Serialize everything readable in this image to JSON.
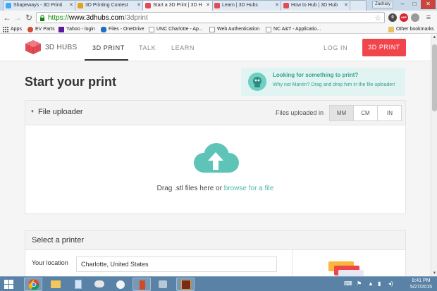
{
  "browser": {
    "tabs": [
      {
        "title": "Shapeways - 3D Printi",
        "icon": "shapeways-favicon",
        "color": "#3fa9f5",
        "active": false
      },
      {
        "title": "3D Printing Contest",
        "icon": "contest-favicon",
        "color": "#e3a21a",
        "active": false
      },
      {
        "title": "Start a 3D Print | 3D H",
        "icon": "3dhubs-favicon",
        "color": "#e24a55",
        "active": true
      },
      {
        "title": "Learn | 3D Hubs",
        "icon": "3dhubs-favicon",
        "color": "#e24a55",
        "active": false
      },
      {
        "title": "How to Hub | 3D Hub",
        "icon": "3dhubs-favicon",
        "color": "#e24a55",
        "active": false
      }
    ],
    "profile": "Zachary",
    "url": {
      "scheme": "https://",
      "host": "www.3dhubs.com",
      "path": "/3dprint"
    },
    "extensions": [
      "ghostery-icon",
      "adblock-icon",
      "pin-icon"
    ],
    "extension_labels": [
      "0",
      "ABP",
      ""
    ],
    "bookmarks": [
      {
        "label": "Apps",
        "icon": "apps-grid-icon"
      },
      {
        "label": "EV Parts",
        "icon": "ev-parts-icon"
      },
      {
        "label": "Yahoo - login",
        "icon": "yahoo-icon"
      },
      {
        "label": "Files - OneDrive",
        "icon": "onedrive-icon"
      },
      {
        "label": "UNC Charlotte - Ap...",
        "icon": "page-icon"
      },
      {
        "label": "Web Authentication",
        "icon": "page-icon"
      },
      {
        "label": "NC A&T - Applicatio...",
        "icon": "page-icon"
      }
    ],
    "other_bookmarks": "Other bookmarks"
  },
  "site": {
    "logo_text": "3D HUBS",
    "nav": [
      "3D PRINT",
      "TALK",
      "LEARN"
    ],
    "login": "LOG IN",
    "cta": "3D PRINT",
    "accent": "#f0454b",
    "teal": "#4fb8aa"
  },
  "page": {
    "title": "Start your print",
    "promo_title": "Looking for something to print?",
    "promo_sub": "Why not Marvin? Drag and drop him in the file uploader!"
  },
  "uploader": {
    "title": "File uploader",
    "units_label": "Files uploaded in",
    "units": [
      "MM",
      "CM",
      "IN"
    ],
    "selected_unit": "MM",
    "drop_text": "Drag .stl files here or",
    "drop_link": "browse for a file"
  },
  "printer": {
    "title": "Select a printer",
    "location_label": "Your location",
    "location_value": "Charlotte, United States"
  },
  "taskbar": {
    "apps": [
      "windows-start-icon",
      "chrome-icon",
      "file-explorer-icon",
      "notes-icon",
      "chat-icon",
      "paint-icon",
      "ironman-icon",
      "tools-icon",
      "revit-icon"
    ],
    "time": "8:41 PM",
    "date": "5/27/2015"
  }
}
